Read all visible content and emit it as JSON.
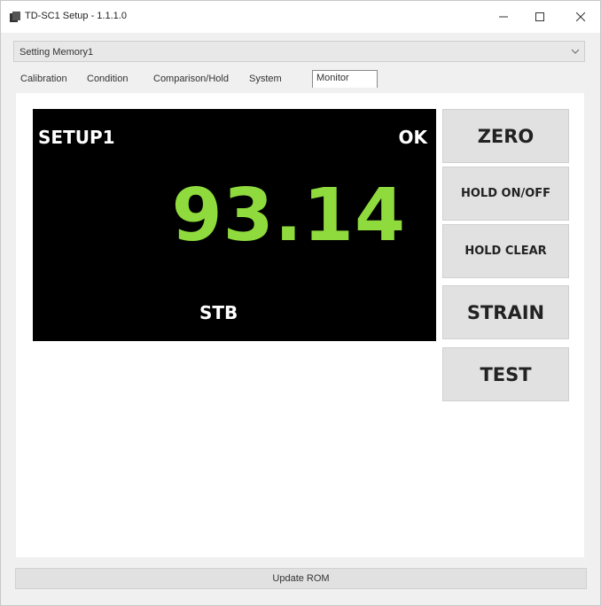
{
  "window": {
    "title": "TD-SC1 Setup - 1.1.1.0"
  },
  "memory_select": {
    "value": "Setting Memory1"
  },
  "tabs": [
    {
      "label": "Calibration"
    },
    {
      "label": "Condition"
    },
    {
      "label": "Comparison/Hold"
    },
    {
      "label": "System"
    },
    {
      "label": "Monitor",
      "active": true
    }
  ],
  "display": {
    "setup_label": "SETUP1",
    "status": "OK",
    "value": "93.14",
    "state": "STB",
    "value_color": "#8fdb3d",
    "background": "#000000"
  },
  "buttons": {
    "zero": "ZERO",
    "hold_toggle": "HOLD ON/OFF",
    "hold_clear": "HOLD CLEAR",
    "strain": "STRAIN",
    "test": "TEST"
  },
  "footer": {
    "update_label": "Update ROM"
  }
}
